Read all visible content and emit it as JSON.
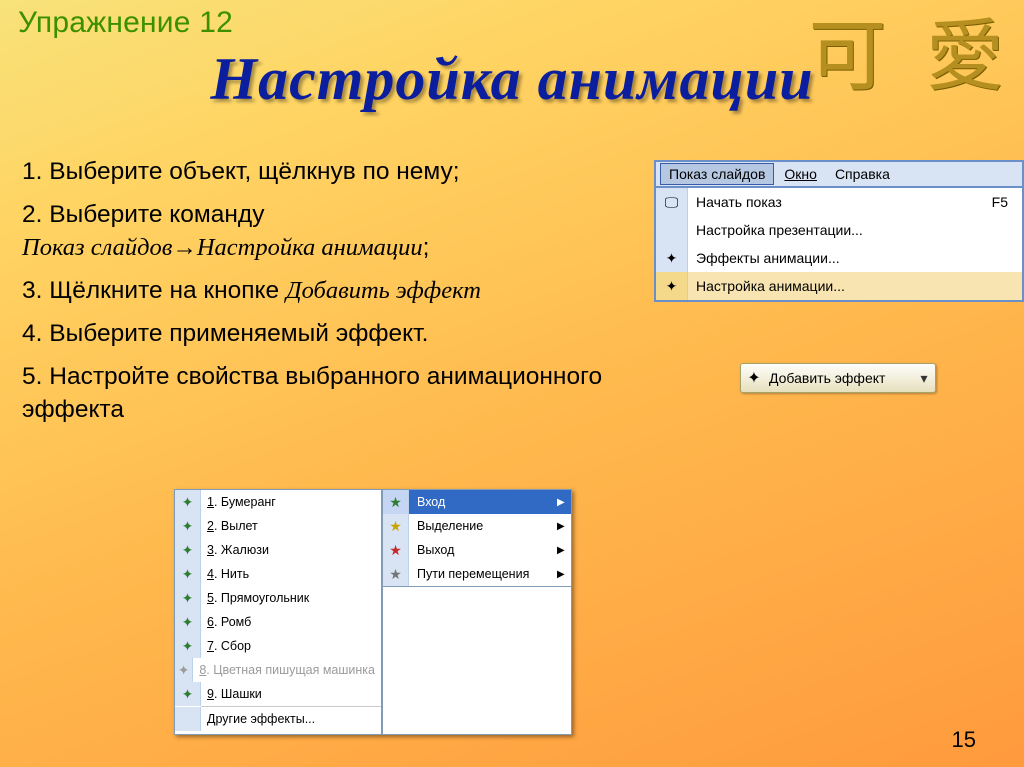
{
  "exercise_label": "Упражнение 12",
  "deco_glyphs": "可 愛",
  "title": "Настройка анимации",
  "page_number": "15",
  "steps": [
    {
      "num": "1.",
      "text": "Выберите объект, щёлкнув по нему",
      "cmd": "",
      "tail": ";"
    },
    {
      "num": "2.",
      "text": "Выберите команду",
      "cmd": "Показ слайдов→Настройка анимации",
      "tail": ";"
    },
    {
      "num": "3.",
      "text": "Щёлкните на кнопке ",
      "cmd": "Добавить эффект",
      "tail": ""
    },
    {
      "num": "4.",
      "text": "Выберите применяемый эффект.",
      "cmd": "",
      "tail": ""
    },
    {
      "num": "5.",
      "text": "Настройте свойства выбранного анимационного эффекта",
      "cmd": "",
      "tail": ""
    }
  ],
  "menubar": {
    "items": [
      "Показ слайдов",
      "Окно",
      "Справка"
    ],
    "underline_idx": [
      0,
      0,
      0
    ]
  },
  "dropdown": [
    {
      "icon": "🖵",
      "label": "Начать показ",
      "shortcut": "F5",
      "hl": false
    },
    {
      "icon": "",
      "label": "Настройка презентации...",
      "shortcut": "",
      "hl": false
    },
    {
      "icon": "✦",
      "label": "Эффекты анимации...",
      "shortcut": "",
      "hl": false
    },
    {
      "icon": "✦",
      "label": "Настройка анимации...",
      "shortcut": "",
      "hl": true
    }
  ],
  "add_effect_btn": {
    "icon": "✦",
    "label": "Добавить эффект",
    "arrow": "▾"
  },
  "fx_list": [
    {
      "n": "1",
      "label": "Бумеранг",
      "dis": false
    },
    {
      "n": "2",
      "label": "Вылет",
      "dis": false
    },
    {
      "n": "3",
      "label": "Жалюзи",
      "dis": false
    },
    {
      "n": "4",
      "label": "Нить",
      "dis": false
    },
    {
      "n": "5",
      "label": "Прямоугольник",
      "dis": false
    },
    {
      "n": "6",
      "label": "Ромб",
      "dis": false
    },
    {
      "n": "7",
      "label": "Сбор",
      "dis": false
    },
    {
      "n": "8",
      "label": "Цветная пишущая машинка",
      "dis": true
    },
    {
      "n": "9",
      "label": "Шашки",
      "dis": false
    }
  ],
  "fx_other": "Другие эффекты...",
  "categories": [
    {
      "icon": "★",
      "color": "#2e7d32",
      "label": "Вход",
      "hl": true
    },
    {
      "icon": "★",
      "color": "#c9a400",
      "label": "Выделение",
      "hl": false
    },
    {
      "icon": "★",
      "color": "#c62828",
      "label": "Выход",
      "hl": false
    },
    {
      "icon": "★",
      "color": "#757575",
      "label": "Пути перемещения",
      "hl": false
    }
  ]
}
